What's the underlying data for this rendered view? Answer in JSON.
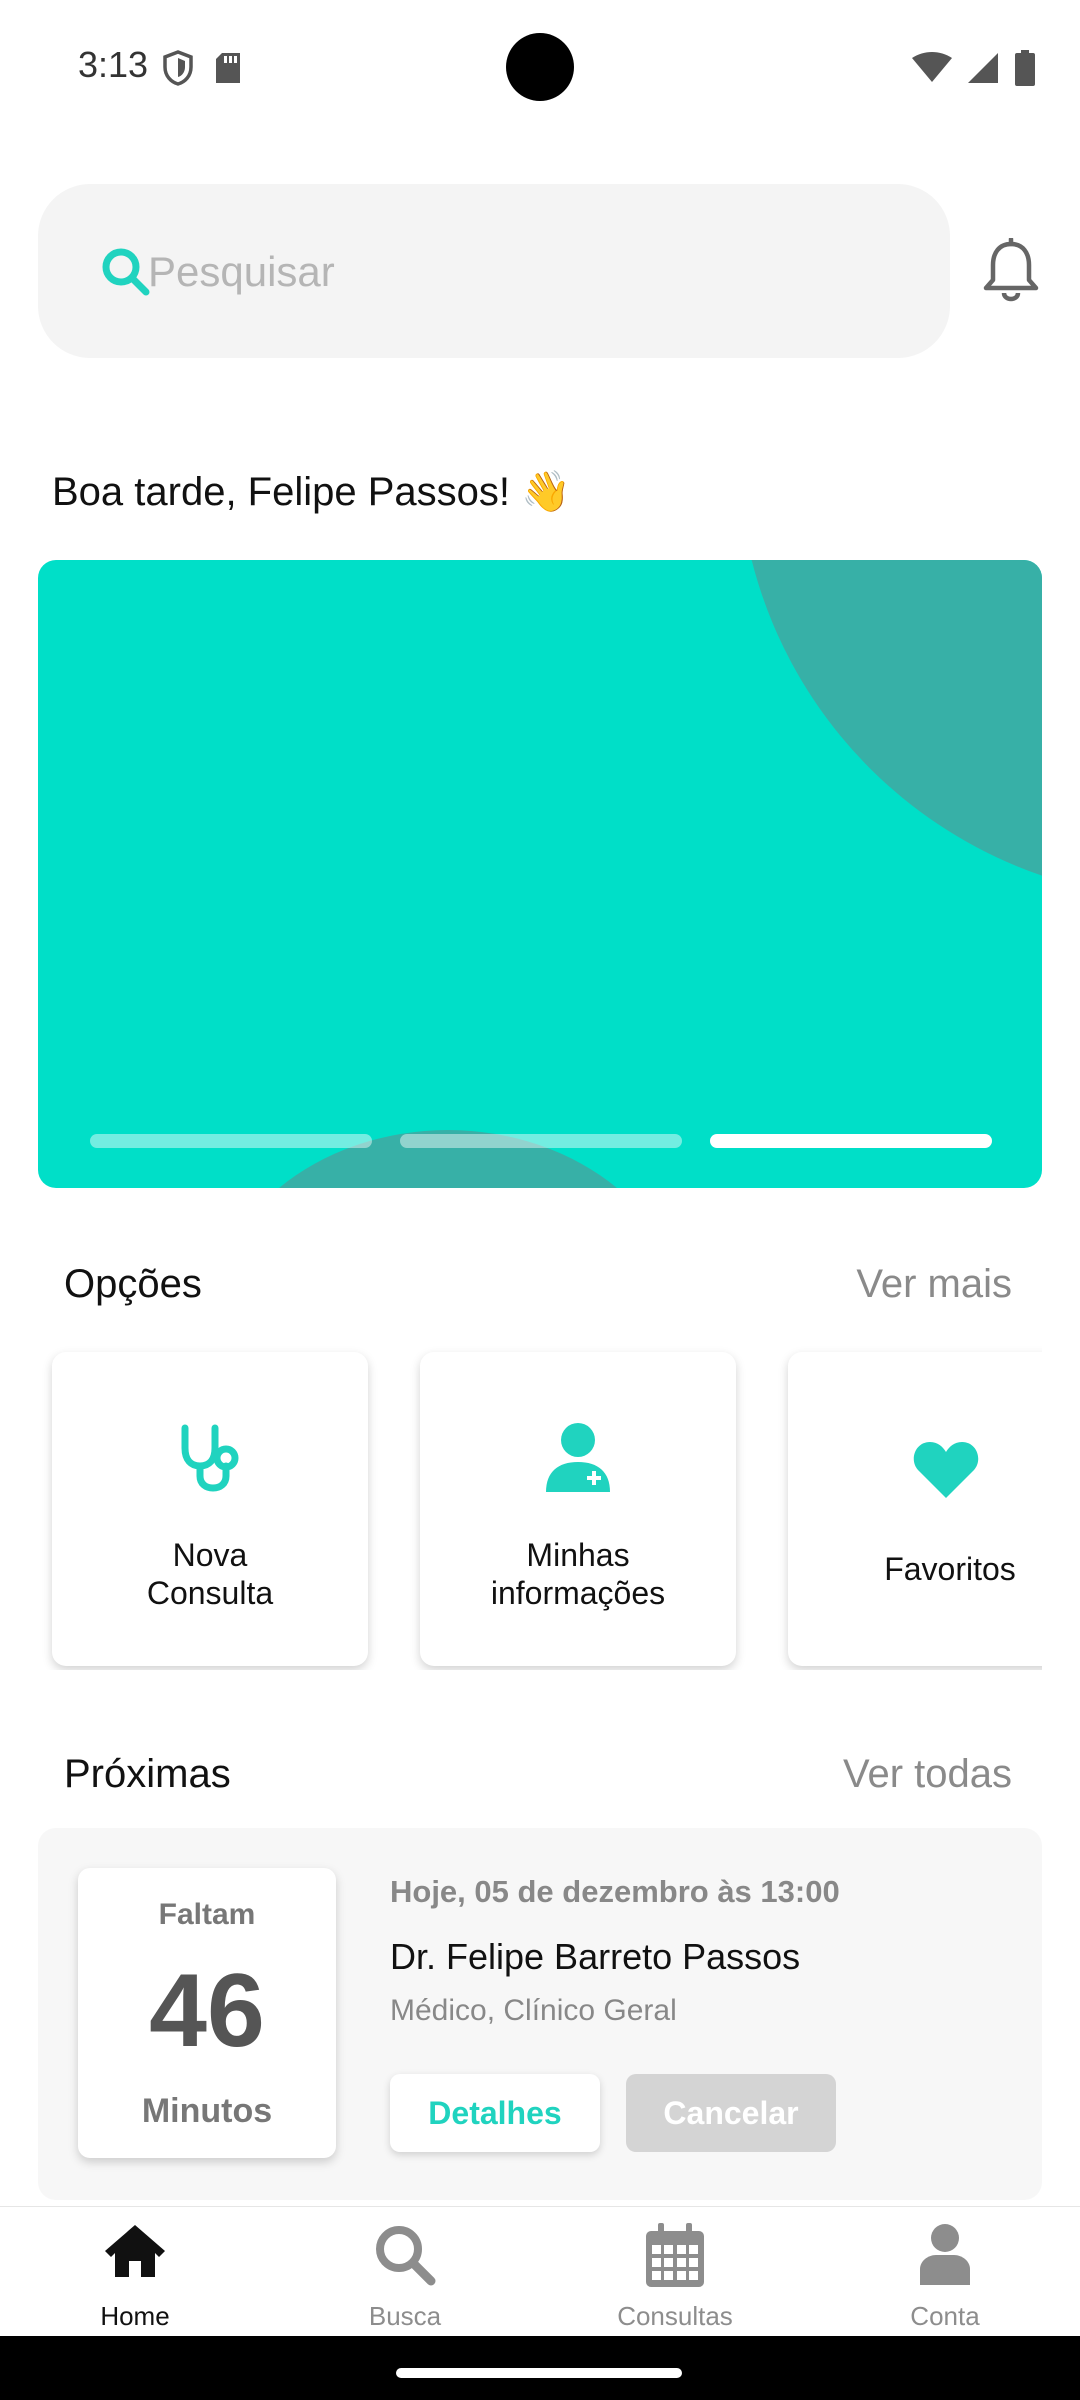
{
  "status_bar": {
    "time": "3:13",
    "icons_left": [
      "shield-icon",
      "sd-card-icon"
    ],
    "icons_right": [
      "wifi-icon",
      "cellular-icon",
      "battery-icon"
    ]
  },
  "search": {
    "placeholder": "Pesquisar",
    "value": ""
  },
  "greeting": "Boa tarde, Felipe Passos! 👋",
  "banner": {
    "slide_count": 3,
    "active_slide": 3,
    "color": "#00dfc8",
    "shape_color": "#37b0a7"
  },
  "options": {
    "title": "Opções",
    "see_more": "Ver mais",
    "items": [
      {
        "label_line1": "Nova",
        "label_line2": "Consulta",
        "icon": "stethoscope-icon"
      },
      {
        "label_line1": "Minhas",
        "label_line2": "informações",
        "icon": "user-plus-icon"
      },
      {
        "label_line1": "Favoritos",
        "icon": "heart-icon"
      }
    ]
  },
  "upcoming": {
    "title": "Próximas",
    "see_all": "Ver todas",
    "appointment": {
      "countdown_top": "Faltam",
      "countdown_value": "46",
      "countdown_unit": "Minutos",
      "date": "Hoje, 05 de dezembro às 13:00",
      "doctor": "Dr. Felipe Barreto Passos",
      "specialty": "Médico, Clínico Geral",
      "details_button": "Detalhes",
      "cancel_button": "Cancelar"
    }
  },
  "bottom_nav": {
    "active": "Home",
    "items": [
      {
        "label": "Home",
        "icon": "home-icon"
      },
      {
        "label": "Busca",
        "icon": "search-icon"
      },
      {
        "label": "Consultas",
        "icon": "calendar-icon"
      },
      {
        "label": "Conta",
        "icon": "user-icon"
      }
    ]
  },
  "colors": {
    "accent": "#20d3bf",
    "muted": "#8a8a8a"
  }
}
